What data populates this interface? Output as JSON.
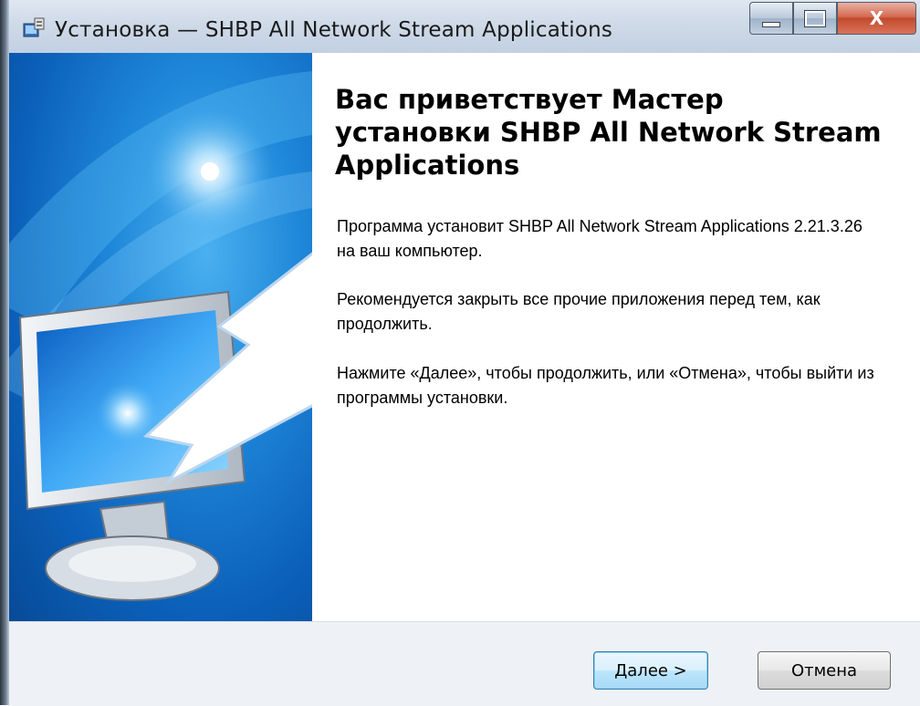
{
  "window": {
    "title": "Установка — SHBP All Network Stream Applications",
    "close_glyph": "X"
  },
  "wizard": {
    "heading": "Вас приветствует Мастер установки SHBP All Network Stream Applications",
    "paragraphs": [
      "Программа установит SHBP All Network Stream Applications 2.21.3.26 на ваш компьютер.",
      "Рекомендуется закрыть все прочие приложения перед тем, как продолжить.",
      "Нажмите «Далее», чтобы продолжить, или «Отмена», чтобы выйти из программы установки."
    ]
  },
  "footer": {
    "next_label": "Далее >",
    "cancel_label": "Отмена"
  },
  "colors": {
    "banner_blue": "#0b5fb8",
    "next_button_border": "#3c7fb1",
    "close_button": "#c24a2e"
  },
  "icons": {
    "app": "installer-icon",
    "minimize": "minimize-icon",
    "maximize": "maximize-icon",
    "close": "close-icon",
    "banner": "monitor-arrow-illustration"
  }
}
